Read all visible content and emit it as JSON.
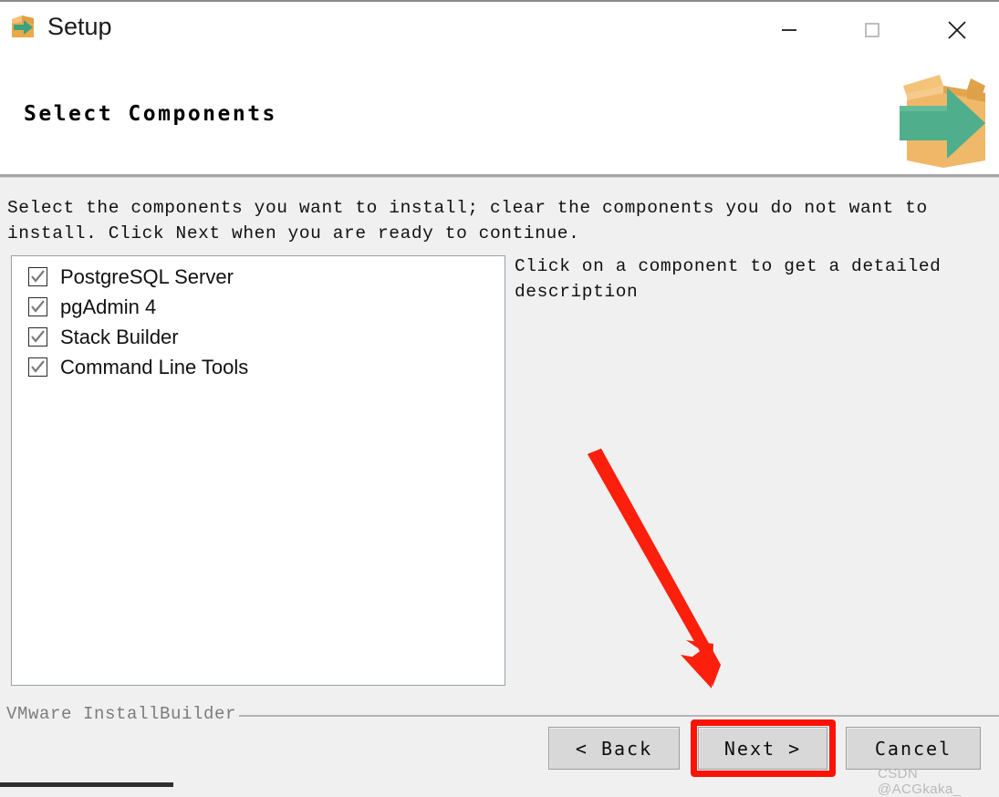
{
  "window": {
    "title": "Setup",
    "app_icon": "installer-box-arrow-icon",
    "controls": {
      "minimize": "minimize-icon",
      "maximize": "maximize-icon",
      "close": "close-icon"
    }
  },
  "header": {
    "title": "Select Components",
    "logo": "installer-box-arrow-logo"
  },
  "body": {
    "instructions": "Select the components you want to install; clear the components you do not want to\ninstall. Click Next when you are ready to continue.",
    "description": "Click on a component to get a detailed\ndescription",
    "components": [
      {
        "label": "PostgreSQL Server",
        "checked": true
      },
      {
        "label": "pgAdmin 4",
        "checked": true
      },
      {
        "label": "Stack Builder",
        "checked": true
      },
      {
        "label": "Command Line Tools",
        "checked": true
      }
    ]
  },
  "footer": {
    "brand": "VMware InstallBuilder",
    "buttons": {
      "back": "< Back",
      "next": "Next >",
      "cancel": "Cancel"
    }
  },
  "annotations": {
    "arrow": "red-arrow-pointing-to-next-button",
    "highlight_target": "Next >",
    "color": "#fc1202"
  },
  "watermark": "CSDN @ACGkaka_"
}
